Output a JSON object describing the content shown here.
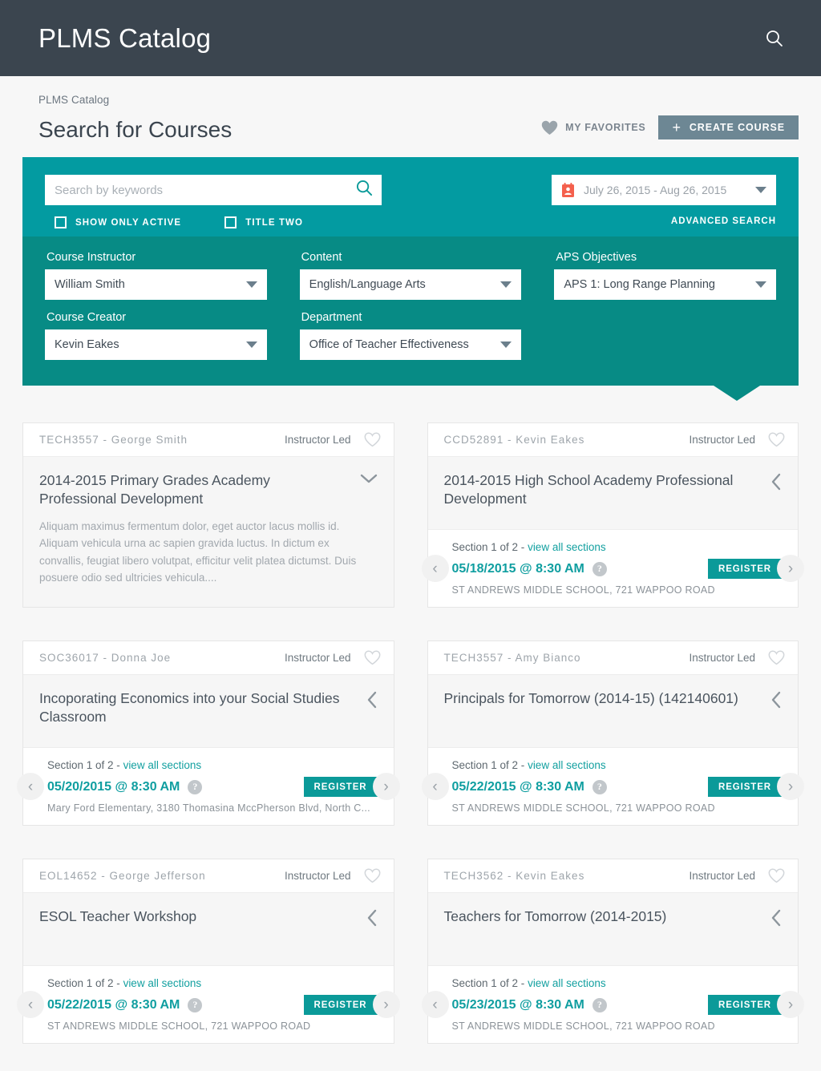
{
  "appbar": {
    "title": "PLMS Catalog",
    "search_icon": "search-icon"
  },
  "breadcrumb": "PLMS Catalog",
  "page_title": "Search for Courses",
  "head_actions": {
    "favorites_label": "MY FAVORITES",
    "favorites_icon": "heart-icon",
    "create_label": "CREATE COURSE",
    "create_icon": "plus-icon",
    "create_color": "#6d8794"
  },
  "search_panel": {
    "accent_light": "#039ba1",
    "accent_dark": "#078b85",
    "keyword_placeholder": "Search by keywords",
    "keyword_value": "",
    "search_icon": "search-icon",
    "checkboxes": [
      {
        "label": "SHOW ONLY ACTIVE",
        "checked": false
      },
      {
        "label": "TITLE TWO",
        "checked": false
      }
    ],
    "date_range": "July 26, 2015 - Aug 26, 2015",
    "date_icon": "calendar-person-icon",
    "date_icon_color": "#f4604d",
    "advanced_search_label": "ADVANCED SEARCH",
    "filters": [
      {
        "label": "Course Instructor",
        "value": "William Smith"
      },
      {
        "label": "Content",
        "value": "English/Language Arts"
      },
      {
        "label": "APS Objectives",
        "value": "APS 1: Long Range Planning"
      },
      {
        "label": "Course Creator",
        "value": "Kevin Eakes"
      },
      {
        "label": "Department",
        "value": "Office of Teacher Effectiveness"
      }
    ]
  },
  "common": {
    "section_prefix": "Section 1 of 2 - ",
    "view_all_label": "view all sections",
    "register_label": "REGISTER",
    "help_glyph": "?",
    "prev_glyph": "‹",
    "next_glyph": "›"
  },
  "cards": [
    {
      "code": "TECH3557 - George Smith",
      "type": "Instructor Led",
      "title": "2014-2015 Primary Grades Academy Professional Development",
      "expanded": true,
      "toggle_icon": "chevron-down-icon",
      "description": "Aliquam maximus fermentum dolor, eget auctor lacus mollis id. Aliquam vehicula urna ac sapien gravida luctus. In dictum ex convallis, feugiat libero volutpat, efficitur velit platea dictumst. Duis posuere odio sed ultricies vehicula....",
      "section": null
    },
    {
      "code": "CCD52891 - Kevin Eakes",
      "type": "Instructor Led",
      "title": "2014-2015 High School Academy Professional Development",
      "expanded": false,
      "toggle_icon": "chevron-left-icon",
      "description": null,
      "section": {
        "count_text": "Section 1 of 2 - ",
        "view_all": "view all sections",
        "date": "05/18/2015 @ 8:30 AM",
        "location": "ST ANDREWS MIDDLE SCHOOL, 721 WAPPOO ROAD",
        "register": "REGISTER"
      }
    },
    {
      "code": "SOC36017 - Donna Joe",
      "type": "Instructor Led",
      "title": "Incoporating Economics into your Social Studies Classroom",
      "expanded": false,
      "toggle_icon": "chevron-left-icon",
      "description": null,
      "section": {
        "count_text": "Section 1 of 2 - ",
        "view_all": "view all sections",
        "date": "05/20/2015 @ 8:30 AM",
        "location": "Mary Ford Elementary, 3180 Thomasina MccPherson Blvd, North C...",
        "register": "REGISTER"
      }
    },
    {
      "code": "TECH3557 - Amy Bianco",
      "type": "Instructor Led",
      "title": "Principals for Tomorrow (2014-15) (142140601)",
      "expanded": false,
      "toggle_icon": "chevron-left-icon",
      "description": null,
      "section": {
        "count_text": "Section 1 of 2 - ",
        "view_all": "view all sections",
        "date": "05/22/2015 @ 8:30 AM",
        "location": "ST ANDREWS MIDDLE SCHOOL, 721 WAPPOO ROAD",
        "register": "REGISTER"
      }
    },
    {
      "code": "EOL14652 - George Jefferson",
      "type": "Instructor Led",
      "title": "ESOL Teacher Workshop",
      "expanded": false,
      "toggle_icon": "chevron-left-icon",
      "description": null,
      "section": {
        "count_text": "Section 1 of 2 - ",
        "view_all": "view all sections",
        "date": "05/22/2015 @ 8:30 AM",
        "location": "ST ANDREWS MIDDLE SCHOOL, 721 WAPPOO ROAD",
        "register": "REGISTER"
      }
    },
    {
      "code": "TECH3562 - Kevin Eakes",
      "type": "Instructor Led",
      "title": "Teachers for Tomorrow (2014-2015)",
      "expanded": false,
      "toggle_icon": "chevron-left-icon",
      "description": null,
      "section": {
        "count_text": "Section 1 of 2 - ",
        "view_all": "view all sections",
        "date": "05/23/2015 @ 8:30 AM",
        "location": "ST ANDREWS MIDDLE SCHOOL, 721 WAPPOO ROAD",
        "register": "REGISTER"
      }
    }
  ]
}
